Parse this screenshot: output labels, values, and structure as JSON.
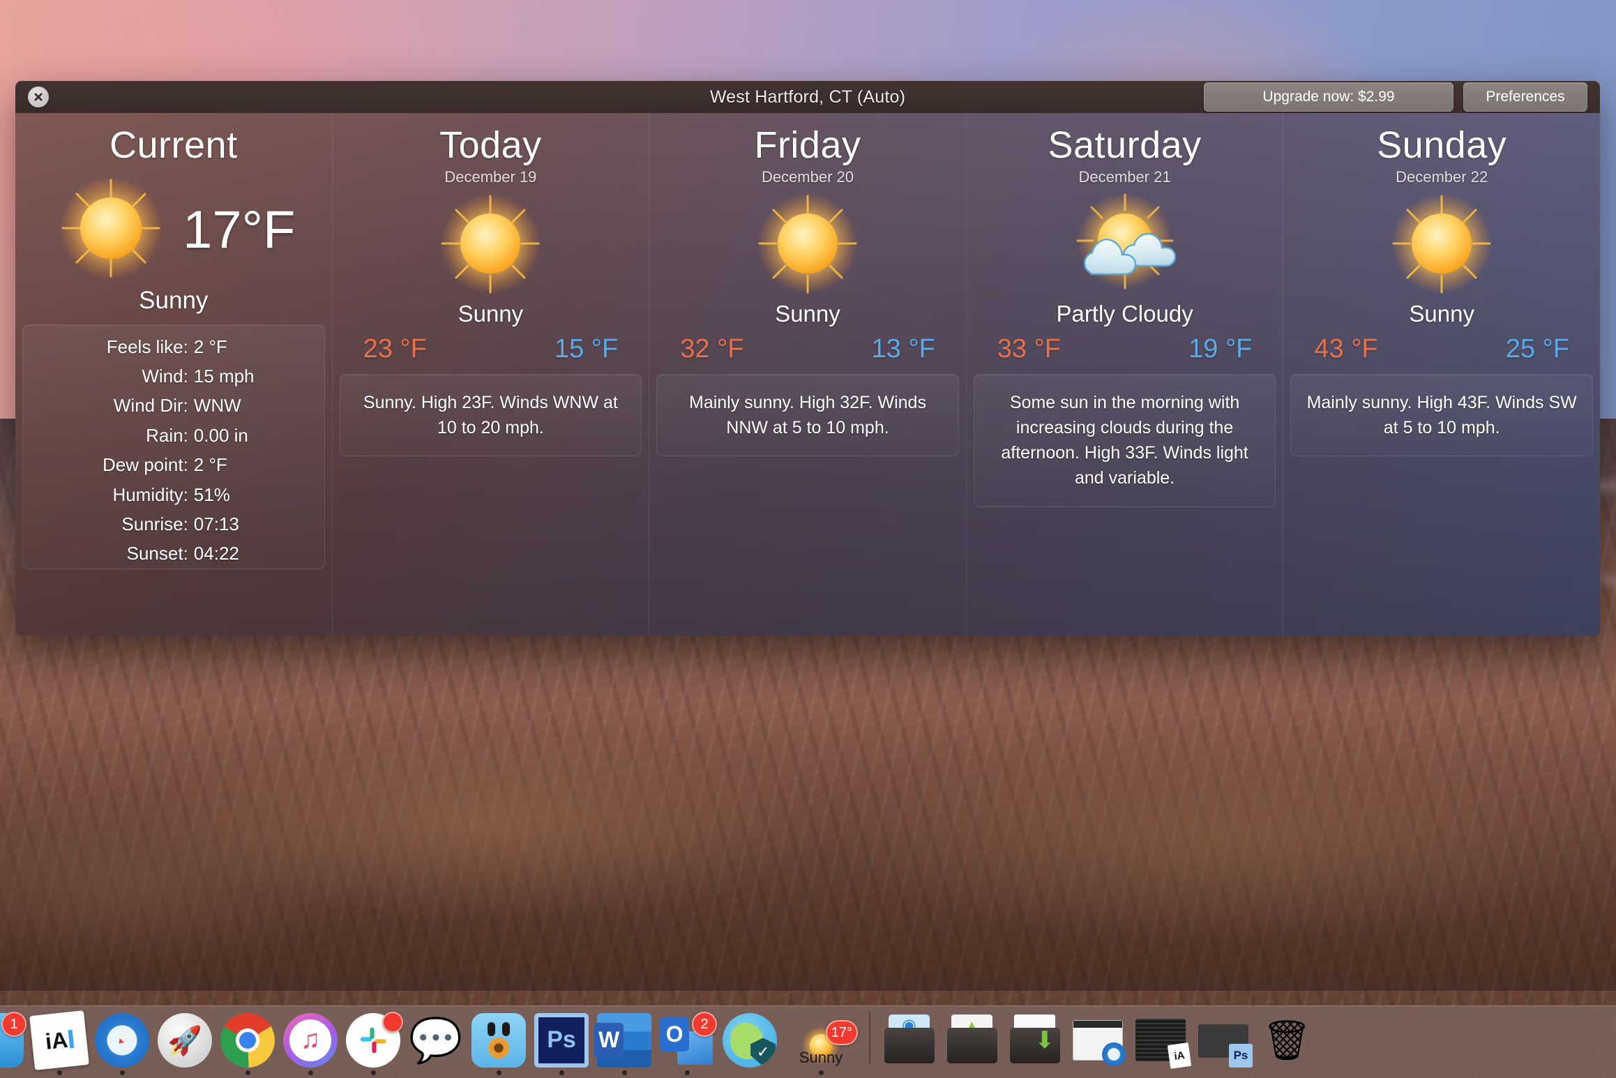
{
  "window": {
    "title": "West Hartford, CT (Auto)",
    "close_icon": "close-icon",
    "upgrade_label": "Upgrade now: $2.99",
    "preferences_label": "Preferences"
  },
  "colors": {
    "high_temp": "#e8714a",
    "low_temp": "#5aaae8",
    "badge": "#f23b2e"
  },
  "current": {
    "heading": "Current",
    "icon": "sun-icon",
    "temperature": "17°F",
    "condition": "Sunny",
    "details": [
      {
        "label": "Feels like:",
        "value": "2 °F"
      },
      {
        "label": "Wind:",
        "value": "15 mph"
      },
      {
        "label": "Wind Dir:",
        "value": "WNW"
      },
      {
        "label": "Rain:",
        "value": "0.00 in"
      },
      {
        "label": "Dew point:",
        "value": "2 °F"
      },
      {
        "label": "Humidity:",
        "value": "51%"
      },
      {
        "label": "Sunrise:",
        "value": "07:13"
      },
      {
        "label": "Sunset:",
        "value": "04:22"
      }
    ]
  },
  "forecast": [
    {
      "day": "Today",
      "date": "December 19",
      "icon": "sun-icon",
      "condition": "Sunny",
      "high": "23 °F",
      "low": "15 °F",
      "description": "Sunny. High 23F. Winds WNW at 10 to 20 mph."
    },
    {
      "day": "Friday",
      "date": "December 20",
      "icon": "sun-icon",
      "condition": "Sunny",
      "high": "32 °F",
      "low": "13 °F",
      "description": "Mainly sunny. High 32F. Winds NNW at 5 to 10 mph."
    },
    {
      "day": "Saturday",
      "date": "December 21",
      "icon": "sun-behind-clouds-icon",
      "condition": "Partly Cloudy",
      "high": "33 °F",
      "low": "19 °F",
      "description": "Some sun in the morning with increasing clouds during the afternoon. High 33F. Winds light and variable."
    },
    {
      "day": "Sunday",
      "date": "December 22",
      "icon": "sun-icon",
      "condition": "Sunny",
      "high": "43 °F",
      "low": "25 °F",
      "description": "Mainly sunny. High 43F. Winds SW at 5 to 10 mph."
    }
  ],
  "dock": {
    "weather_badge": "17°",
    "weather_label": "Sunny",
    "finder_badge": "1",
    "slack_badge": "",
    "outlook_badge": "2",
    "items": [
      {
        "name": "finder",
        "badge": "1",
        "running": true
      },
      {
        "name": "ia-writer",
        "badge": "",
        "running": true
      },
      {
        "name": "safari",
        "badge": "",
        "running": true
      },
      {
        "name": "launchpad",
        "badge": "",
        "running": false
      },
      {
        "name": "chrome",
        "badge": "",
        "running": true
      },
      {
        "name": "itunes",
        "badge": "",
        "running": true
      },
      {
        "name": "slack",
        "badge": "",
        "running": true
      },
      {
        "name": "messages",
        "badge": "",
        "running": false
      },
      {
        "name": "tweetbot",
        "badge": "",
        "running": true
      },
      {
        "name": "photoshop",
        "badge": "",
        "running": true
      },
      {
        "name": "word",
        "badge": "",
        "running": true
      },
      {
        "name": "outlook",
        "badge": "2",
        "running": true
      },
      {
        "name": "vpn-globe",
        "badge": "",
        "running": false
      },
      {
        "name": "weather",
        "badge": "17°",
        "running": true
      }
    ],
    "stacks": [
      {
        "name": "airdrop-folder"
      },
      {
        "name": "android-folder"
      },
      {
        "name": "downloads-folder"
      },
      {
        "name": "minimized-safari-window"
      },
      {
        "name": "minimized-ia-writer-window"
      },
      {
        "name": "minimized-photoshop-window"
      },
      {
        "name": "trash"
      }
    ]
  }
}
